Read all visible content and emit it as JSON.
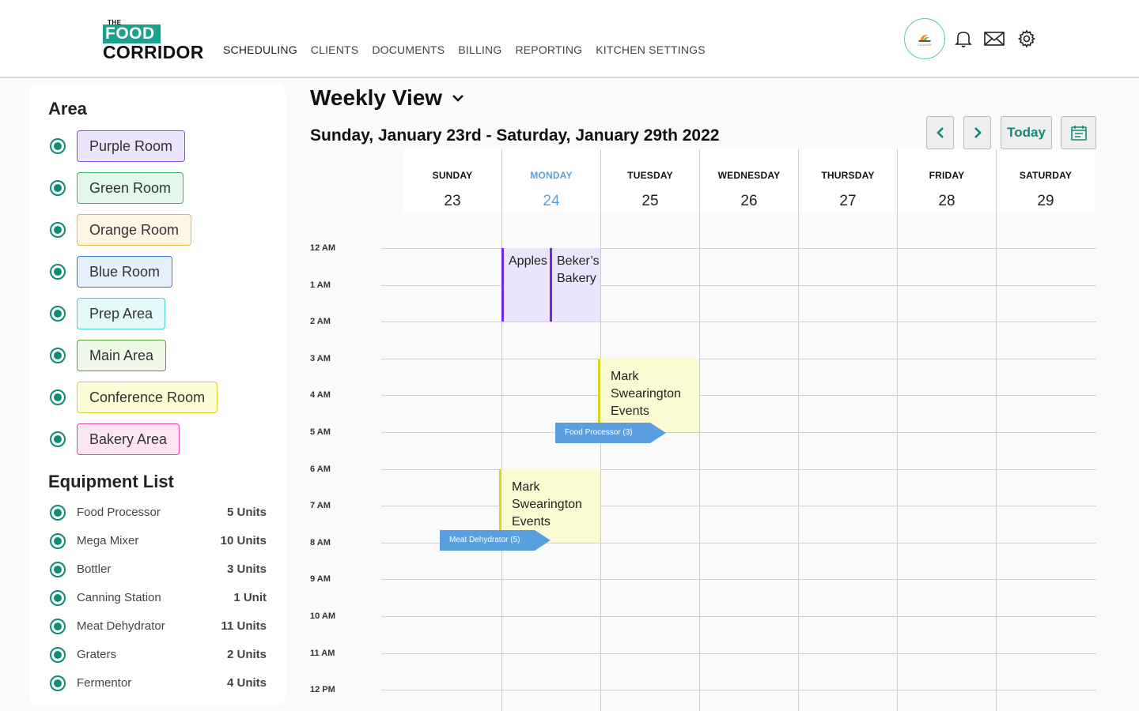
{
  "brand": {
    "the": "THE",
    "food": "FOOD",
    "corridor": "CORRIDOR"
  },
  "nav": [
    "SCHEDULING",
    "CLIENTS",
    "DOCUMENTS",
    "BILLING",
    "REPORTING",
    "KITCHEN SETTINGS"
  ],
  "avatar_label": "CULINARY",
  "sidebar": {
    "area_title": "Area",
    "rooms": [
      {
        "label": "Purple Room",
        "bg": "#ede4fd",
        "border": "#8a4ee8"
      },
      {
        "label": "Green Room",
        "bg": "#e3f8ea",
        "border": "#36b86a"
      },
      {
        "label": "Orange Room",
        "bg": "#fff5e3",
        "border": "#f2b24a"
      },
      {
        "label": "Blue Room",
        "bg": "#e5f0fd",
        "border": "#3c7ed6"
      },
      {
        "label": "Prep Area",
        "bg": "#e5fafa",
        "border": "#4fcfcf"
      },
      {
        "label": "Main Area",
        "bg": "#f0f8e8",
        "border": "#5a9c3a"
      },
      {
        "label": "Conference Room",
        "bg": "#fdfdd8",
        "border": "#d8cc2a"
      },
      {
        "label": "Bakery Area",
        "bg": "#fde6f4",
        "border": "#e044a8"
      }
    ],
    "equipment_title": "Equipment List",
    "equipment": [
      {
        "name": "Food Processor",
        "units": "5 Units"
      },
      {
        "name": "Mega Mixer",
        "units": "10 Units"
      },
      {
        "name": "Bottler",
        "units": "3 Units"
      },
      {
        "name": "Canning Station",
        "units": "1 Unit"
      },
      {
        "name": "Meat Dehydrator",
        "units": "11 Units"
      },
      {
        "name": "Graters",
        "units": "2 Units"
      },
      {
        "name": "Fermentor",
        "units": "4 Units"
      }
    ]
  },
  "main": {
    "view_title": "Weekly View",
    "date_range": "Sunday, January 23rd - Saturday, January 29th 2022",
    "today_label": "Today"
  },
  "calendar": {
    "days": [
      {
        "name": "SUNDAY",
        "num": "23"
      },
      {
        "name": "MONDAY",
        "num": "24",
        "today": true
      },
      {
        "name": "TUESDAY",
        "num": "25"
      },
      {
        "name": "WEDNESDAY",
        "num": "26"
      },
      {
        "name": "THURSDAY",
        "num": "27"
      },
      {
        "name": "FRIDAY",
        "num": "28"
      },
      {
        "name": "SATURDAY",
        "num": "29"
      }
    ],
    "times": [
      "12 AM",
      "1 AM",
      "2 AM",
      "3 AM",
      "4 AM",
      "5 AM",
      "6 AM",
      "7 AM",
      "8 AM",
      "9 AM",
      "10 AM",
      "11 AM",
      "12 PM"
    ],
    "events": [
      {
        "title": "Apples",
        "day": "MONDAY",
        "start": "12 AM",
        "end": "2 AM",
        "color": "purple"
      },
      {
        "title": "Beker’s Bakery",
        "day": "MONDAY",
        "start": "12 AM",
        "end": "2 AM",
        "color": "purple"
      },
      {
        "title": "Mark Swearington Events",
        "day": "TUESDAY",
        "start": "3 AM",
        "end": "5 AM",
        "color": "yellow"
      },
      {
        "title": "Mark Swearington Events",
        "day": "MONDAY",
        "start": "6 AM",
        "end": "8 AM",
        "color": "yellow"
      }
    ],
    "equipment_tags": [
      {
        "label": "Food Processor (3)"
      },
      {
        "label": "Meat Dehydrator (5)"
      }
    ]
  }
}
